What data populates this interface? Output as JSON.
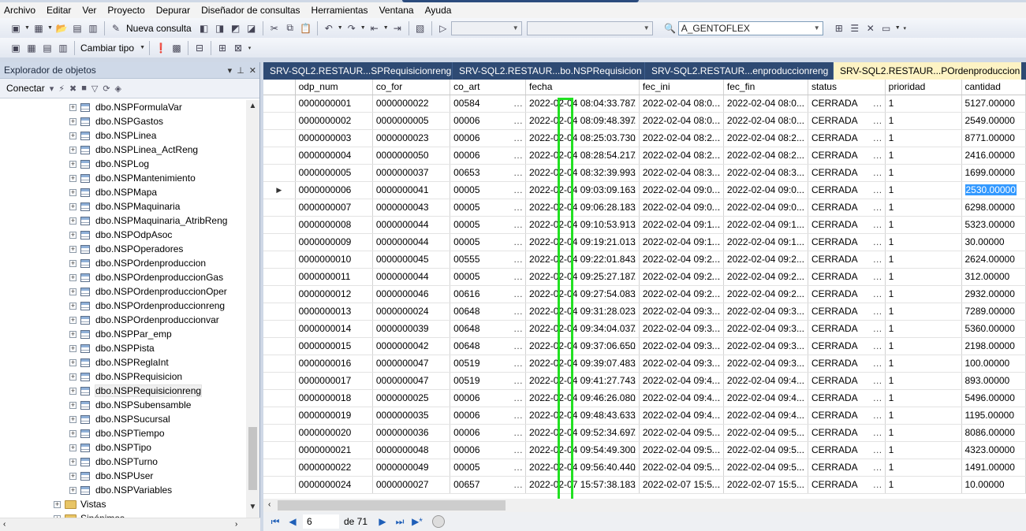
{
  "menu": [
    "Archivo",
    "Editar",
    "Ver",
    "Proyecto",
    "Depurar",
    "Diseñador de consultas",
    "Herramientas",
    "Ventana",
    "Ayuda"
  ],
  "toolbar": {
    "new_query": "Nueva consulta",
    "database_combo": "A_GENTOFLEX",
    "change_type": "Cambiar tipo"
  },
  "explorer": {
    "title": "Explorador de objetos",
    "connect": "Conectar",
    "tree": [
      {
        "label": "dbo.NSPFormulaVar"
      },
      {
        "label": "dbo.NSPGastos"
      },
      {
        "label": "dbo.NSPLinea"
      },
      {
        "label": "dbo.NSPLinea_ActReng"
      },
      {
        "label": "dbo.NSPLog"
      },
      {
        "label": "dbo.NSPMantenimiento"
      },
      {
        "label": "dbo.NSPMapa"
      },
      {
        "label": "dbo.NSPMaquinaria"
      },
      {
        "label": "dbo.NSPMaquinaria_AtribReng"
      },
      {
        "label": "dbo.NSPOdpAsoc"
      },
      {
        "label": "dbo.NSPOperadores"
      },
      {
        "label": "dbo.NSPOrdenproduccion"
      },
      {
        "label": "dbo.NSPOrdenproduccionGas"
      },
      {
        "label": "dbo.NSPOrdenproduccionOper"
      },
      {
        "label": "dbo.NSPOrdenproduccionreng"
      },
      {
        "label": "dbo.NSPOrdenproduccionvar"
      },
      {
        "label": "dbo.NSPPar_emp"
      },
      {
        "label": "dbo.NSPPista"
      },
      {
        "label": "dbo.NSPReglaInt"
      },
      {
        "label": "dbo.NSPRequisicion"
      },
      {
        "label": "dbo.NSPRequisicionreng"
      },
      {
        "label": "dbo.NSPSubensamble"
      },
      {
        "label": "dbo.NSPSucursal"
      },
      {
        "label": "dbo.NSPTiempo"
      },
      {
        "label": "dbo.NSPTipo"
      },
      {
        "label": "dbo.NSPTurno"
      },
      {
        "label": "dbo.NSPUser"
      },
      {
        "label": "dbo.NSPVariables"
      }
    ],
    "folders": [
      "Vistas",
      "Sinónimos"
    ],
    "selected_index": 20
  },
  "tabs": [
    {
      "label": "SRV-SQL2.RESTAUR...SPRequisicionreng"
    },
    {
      "label": "SRV-SQL2.RESTAUR...bo.NSPRequisicion"
    },
    {
      "label": "SRV-SQL2.RESTAUR...enproduccionreng"
    },
    {
      "label": "SRV-SQL2.RESTAUR...POrdenproduccion",
      "active": true
    }
  ],
  "grid": {
    "columns": [
      "odp_num",
      "co_for",
      "co_art",
      "fecha",
      "fec_ini",
      "fec_fin",
      "status",
      "prioridad",
      "cantidad"
    ],
    "rows": [
      [
        "0000000001",
        "0000000022",
        "00584",
        "2022-02-04 08:04:33.787",
        "2022-02-04 08:0...",
        "2022-02-04 08:0...",
        "CERRADA",
        "1",
        "5127.00000"
      ],
      [
        "0000000002",
        "0000000005",
        "00006",
        "2022-02-04 08:09:48.397",
        "2022-02-04 08:0...",
        "2022-02-04 08:0...",
        "CERRADA",
        "1",
        "2549.00000"
      ],
      [
        "0000000003",
        "0000000023",
        "00006",
        "2022-02-04 08:25:03.730",
        "2022-02-04 08:2...",
        "2022-02-04 08:2...",
        "CERRADA",
        "1",
        "8771.00000"
      ],
      [
        "0000000004",
        "0000000050",
        "00006",
        "2022-02-04 08:28:54.217",
        "2022-02-04 08:2...",
        "2022-02-04 08:2...",
        "CERRADA",
        "1",
        "2416.00000"
      ],
      [
        "0000000005",
        "0000000037",
        "00653",
        "2022-02-04 08:32:39.993",
        "2022-02-04 08:3...",
        "2022-02-04 08:3...",
        "CERRADA",
        "1",
        "1699.00000"
      ],
      [
        "0000000006",
        "0000000041",
        "00005",
        "2022-02-04 09:03:09.163",
        "2022-02-04 09:0...",
        "2022-02-04 09:0...",
        "CERRADA",
        "1",
        "2530.00000"
      ],
      [
        "0000000007",
        "0000000043",
        "00005",
        "2022-02-04 09:06:28.183",
        "2022-02-04 09:0...",
        "2022-02-04 09:0...",
        "CERRADA",
        "1",
        "6298.00000"
      ],
      [
        "0000000008",
        "0000000044",
        "00005",
        "2022-02-04 09:10:53.913",
        "2022-02-04 09:1...",
        "2022-02-04 09:1...",
        "CERRADA",
        "1",
        "5323.00000"
      ],
      [
        "0000000009",
        "0000000044",
        "00005",
        "2022-02-04 09:19:21.013",
        "2022-02-04 09:1...",
        "2022-02-04 09:1...",
        "CERRADA",
        "1",
        "30.00000"
      ],
      [
        "0000000010",
        "0000000045",
        "00555",
        "2022-02-04 09:22:01.843",
        "2022-02-04 09:2...",
        "2022-02-04 09:2...",
        "CERRADA",
        "1",
        "2624.00000"
      ],
      [
        "0000000011",
        "0000000044",
        "00005",
        "2022-02-04 09:25:27.187",
        "2022-02-04 09:2...",
        "2022-02-04 09:2...",
        "CERRADA",
        "1",
        "312.00000"
      ],
      [
        "0000000012",
        "0000000046",
        "00616",
        "2022-02-04 09:27:54.083",
        "2022-02-04 09:2...",
        "2022-02-04 09:2...",
        "CERRADA",
        "1",
        "2932.00000"
      ],
      [
        "0000000013",
        "0000000024",
        "00648",
        "2022-02-04 09:31:28.023",
        "2022-02-04 09:3...",
        "2022-02-04 09:3...",
        "CERRADA",
        "1",
        "7289.00000"
      ],
      [
        "0000000014",
        "0000000039",
        "00648",
        "2022-02-04 09:34:04.037",
        "2022-02-04 09:3...",
        "2022-02-04 09:3...",
        "CERRADA",
        "1",
        "5360.00000"
      ],
      [
        "0000000015",
        "0000000042",
        "00648",
        "2022-02-04 09:37:06.650",
        "2022-02-04 09:3...",
        "2022-02-04 09:3...",
        "CERRADA",
        "1",
        "2198.00000"
      ],
      [
        "0000000016",
        "0000000047",
        "00519",
        "2022-02-04 09:39:07.483",
        "2022-02-04 09:3...",
        "2022-02-04 09:3...",
        "CERRADA",
        "1",
        "100.00000"
      ],
      [
        "0000000017",
        "0000000047",
        "00519",
        "2022-02-04 09:41:27.743",
        "2022-02-04 09:4...",
        "2022-02-04 09:4...",
        "CERRADA",
        "1",
        "893.00000"
      ],
      [
        "0000000018",
        "0000000025",
        "00006",
        "2022-02-04 09:46:26.080",
        "2022-02-04 09:4...",
        "2022-02-04 09:4...",
        "CERRADA",
        "1",
        "5496.00000"
      ],
      [
        "0000000019",
        "0000000035",
        "00006",
        "2022-02-04 09:48:43.633",
        "2022-02-04 09:4...",
        "2022-02-04 09:4...",
        "CERRADA",
        "1",
        "1195.00000"
      ],
      [
        "0000000020",
        "0000000036",
        "00006",
        "2022-02-04 09:52:34.697",
        "2022-02-04 09:5...",
        "2022-02-04 09:5...",
        "CERRADA",
        "1",
        "8086.00000"
      ],
      [
        "0000000021",
        "0000000048",
        "00006",
        "2022-02-04 09:54:49.300",
        "2022-02-04 09:5...",
        "2022-02-04 09:5...",
        "CERRADA",
        "1",
        "4323.00000"
      ],
      [
        "0000000022",
        "0000000049",
        "00005",
        "2022-02-04 09:56:40.440",
        "2022-02-04 09:5...",
        "2022-02-04 09:5...",
        "CERRADA",
        "1",
        "1491.00000"
      ],
      [
        "0000000024",
        "0000000027",
        "00657",
        "2022-02-07 15:57:38.183",
        "2022-02-07 15:5...",
        "2022-02-07 15:5...",
        "CERRADA",
        "1",
        "10.00000"
      ]
    ],
    "current_row_index": 5,
    "highlighted_cell": "2530.00000"
  },
  "navigator": {
    "current_record": "6",
    "of_label": "de 71"
  },
  "colors": {
    "tab_strip": "#2e4a73",
    "active_tab": "#fdf3c4",
    "annotation_box": "#22e022",
    "selection": "#3399ff"
  }
}
